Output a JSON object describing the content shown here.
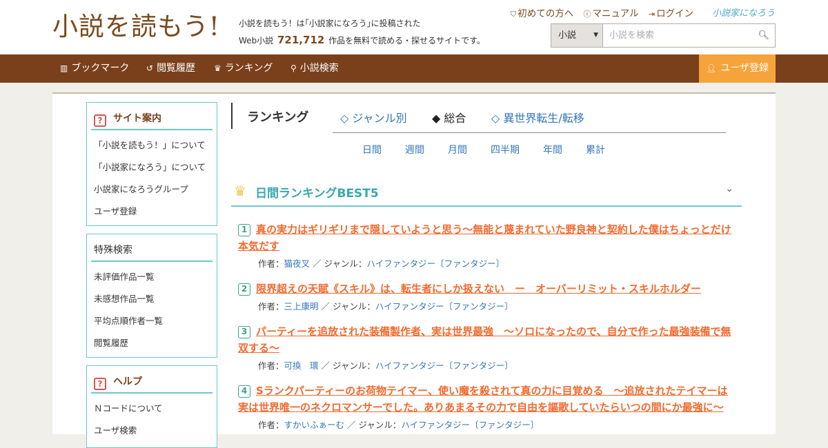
{
  "header": {
    "logo": "小説を読もう!",
    "desc_line1": "小説を読もう！は｢小説家になろう｣に投稿された",
    "desc_prefix": "Web小説",
    "desc_count": "721,712",
    "desc_suffix": "作品を無料で読める・探せるサイトです。",
    "links": [
      "初めての方へ",
      "マニュアル",
      "ログイン"
    ],
    "partner_logo": "小説家になろう",
    "search": {
      "select_value": "小説",
      "placeholder": "小説を検索"
    }
  },
  "nav": {
    "items": [
      "ブックマーク",
      "閲覧履歴",
      "ランキング",
      "小説検索"
    ],
    "user_register": "ユーザ登録"
  },
  "sidebar": {
    "site": {
      "title": "サイト案内",
      "items": [
        "「小説を読もう！」について",
        "「小説家になろう」について",
        "小説家になろうグループ",
        "ユーザ登録"
      ]
    },
    "special": {
      "title": "特殊検索",
      "items": [
        "未評価作品一覧",
        "未感想作品一覧",
        "平均点順作者一覧",
        "閲覧履歴"
      ]
    },
    "help": {
      "title": "ヘルプ",
      "items": [
        "Ｎコードについて",
        "ユーザ検索"
      ]
    }
  },
  "ranking": {
    "title": "ランキング",
    "tabs": [
      "◇ ジャンル別",
      "◆ 総合",
      "◇ 異世界転生/転移"
    ],
    "periods": [
      "日間",
      "週間",
      "月間",
      "四半期",
      "年間",
      "累計"
    ],
    "best_title": "日間ランキングBEST5",
    "author_label": "作者：",
    "genre_label": "／ ジャンル：",
    "entries": [
      {
        "rank": "1",
        "title_1": "真の実力はギリギリまで隠していようと思う～無能と蔑まれていた野良神と契約した僕はちょっとだけ",
        "title_2": "本気だす",
        "author": "猫夜叉",
        "genre": "ハイファンタジー〔ファンタジー〕"
      },
      {
        "rank": "2",
        "title_1": "限界超えの天賦《スキル》は、転生者にしか扱えない　ー　オーバーリミット・スキルホルダー",
        "title_2": "",
        "author": "三上康明",
        "genre": "ハイファンタジー〔ファンタジー〕"
      },
      {
        "rank": "3",
        "title_1": "パーティーを追放された装備製作者、実は世界最強　～ソロになったので、自分で作った最強装備で無",
        "title_2": "双する～",
        "author": "可換　環",
        "genre": "ハイファンタジー〔ファンタジー〕"
      },
      {
        "rank": "4",
        "title_1": "Sランクパーティーのお荷物テイマー、使い魔を殺されて真の力に目覚める　～追放されたテイマーは",
        "title_2": "実は世界唯一のネクロマンサーでした。ありあまるその力で自由を謳歌していたらいつの間にか最強に～",
        "author": "すかいふぁーむ",
        "genre": "ハイファンタジー〔ファンタジー〕"
      }
    ]
  }
}
